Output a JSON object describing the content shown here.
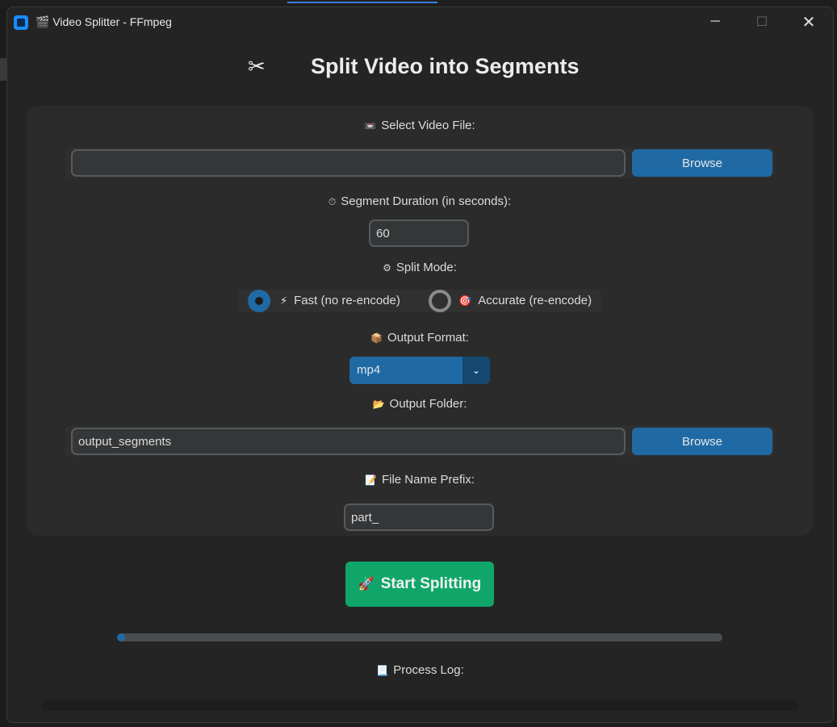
{
  "window": {
    "title": "Video Splitter - FFmpeg",
    "title_icon": "clapper-board-icon",
    "controls": {
      "minimize": "─",
      "maximize": "☐",
      "close": "✕"
    }
  },
  "header": {
    "icon": "✂",
    "title": "Split Video into Segments"
  },
  "video_file": {
    "icon": "📼",
    "label": "Select Video File:",
    "value": "",
    "browse_label": "Browse"
  },
  "segment_duration": {
    "icon": "⏱",
    "label": "Segment Duration (in seconds):",
    "value": "60"
  },
  "split_mode": {
    "icon": "⚙",
    "label": "Split Mode:",
    "options": [
      {
        "icon": "⚡",
        "label": "Fast (no re-encode)",
        "selected": true
      },
      {
        "icon": "🎯",
        "label": "Accurate (re-encode)",
        "selected": false
      }
    ]
  },
  "output_format": {
    "icon": "📦",
    "label": "Output Format:",
    "value": "mp4",
    "arrow": "⌄"
  },
  "output_folder": {
    "icon": "📂",
    "label": "Output Folder:",
    "value": "output_segments",
    "browse_label": "Browse"
  },
  "file_prefix": {
    "icon": "📝",
    "label": "File Name Prefix:",
    "value": "part_"
  },
  "start_button": {
    "icon": "🚀",
    "label": "Start Splitting"
  },
  "progress": {
    "fraction": 0.013
  },
  "log": {
    "icon": "📃",
    "label": "Process Log:",
    "content": ""
  },
  "colors": {
    "accent": "#1f6aa5",
    "start_button": "#10a66a",
    "background": "#242424",
    "panel": "#2b2b2b"
  }
}
